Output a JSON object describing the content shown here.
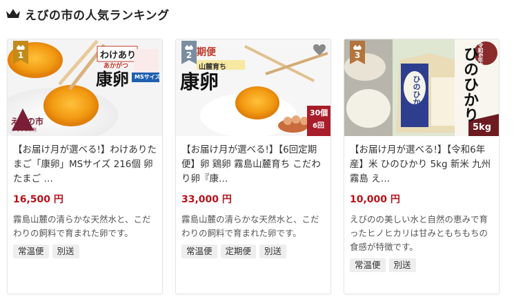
{
  "header": {
    "title": "えびの市の人気ランキング",
    "icon": "crown-icon"
  },
  "colors": {
    "price": "#b5121b",
    "rank1": "#c28b1a",
    "rank2": "#7a8ea0",
    "rank3": "#b3743d"
  },
  "cards": [
    {
      "rank": "1",
      "name": "【お届け月が選べる!】わけありたまご「康卵」MSサイズ 216個 卵 たまご …",
      "price": "16,500 円",
      "description": "霧島山麓の清らかな天然水と、こだわりの飼料で育まれた卵です。",
      "tags": [
        "常温便",
        "別送"
      ],
      "image": {
        "badge": "わけあり",
        "sub": "あかがつ",
        "brand": "康卵",
        "size": "MSサイズ",
        "logo": "えびの市",
        "logo_sub": "ふるさと納税"
      }
    },
    {
      "rank": "2",
      "name": "【お届け月が選べる!】【6回定期便】卵 鶏卵 霧島山麓育ち こだわり卵『康…",
      "price": "33,000 円",
      "description": "霧島山麓の清らかな天然水と、こだわりの飼料で育まれた卵です。",
      "tags": [
        "常温便",
        "定期便",
        "別送"
      ],
      "image": {
        "badge": "期便",
        "sub": "山麓育ち",
        "brand": "康卵",
        "count": "30個",
        "times": "6回"
      }
    },
    {
      "rank": "3",
      "name": "【お届け月が選べる!】【令和6年産】米 ひのひかり 5kg 新米 九州 霧島 え…",
      "price": "10,000 円",
      "description": "えびのの美しい水と自然の恵みで育ったヒノヒカリは甘みともちもちの食感が特徴です。",
      "tags": [
        "常温便",
        "別送"
      ],
      "image": {
        "title": "ひのひかり",
        "year": "令和6年産",
        "weight": "5kg",
        "bag": "ひのひかり"
      }
    }
  ]
}
